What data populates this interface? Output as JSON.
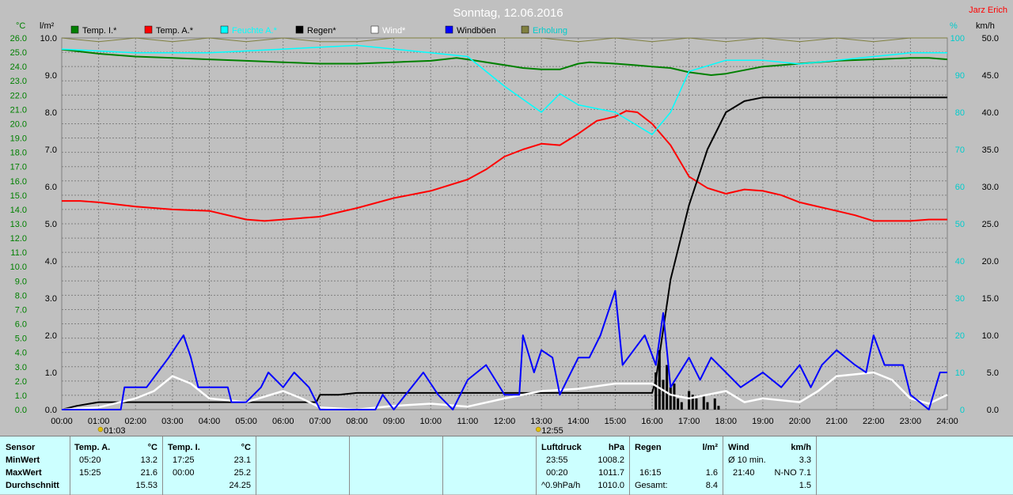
{
  "title": "Sonntag, 12.06.2016",
  "author": "Jarz Erich",
  "axis_units": {
    "left_temp": "°C",
    "left_rain": "l/m²",
    "right_pct": "%",
    "right_kmh": "km/h"
  },
  "legend": [
    {
      "label": "Temp. I.*",
      "color": "#008000"
    },
    {
      "label": "Temp. A.*",
      "color": "#ff0000"
    },
    {
      "label": "Feuchte A.*",
      "color": "#00ffff"
    },
    {
      "label": "Regen*",
      "color": "#000000"
    },
    {
      "label": "Wind*",
      "color": "#ffffff"
    },
    {
      "label": "Windböen",
      "color": "#0000ff"
    },
    {
      "label": "Erholung",
      "color": "#808040"
    }
  ],
  "markers": [
    {
      "label": "01:03"
    },
    {
      "label": "12:55"
    }
  ],
  "chart_data": {
    "type": "line",
    "x_unit": "hours",
    "x_range": [
      0,
      24
    ],
    "x_ticks": [
      "00:00",
      "01:00",
      "02:00",
      "03:00",
      "04:00",
      "05:00",
      "06:00",
      "07:00",
      "08:00",
      "09:00",
      "10:00",
      "11:00",
      "12:00",
      "13:00",
      "14:00",
      "15:00",
      "16:00",
      "17:00",
      "18:00",
      "19:00",
      "20:00",
      "21:00",
      "22:00",
      "23:00",
      "24:00"
    ],
    "temp_axis": {
      "min": 0,
      "max": 26,
      "step": 1
    },
    "rain_axis": {
      "min": 0,
      "max": 10,
      "ticks": [
        "0.0",
        "1.0",
        "2.0",
        "3.0",
        "4.0",
        "5.0",
        "6.0",
        "7.0",
        "8.0",
        "9.0",
        "10.0"
      ]
    },
    "pct_axis": {
      "min": 0,
      "max": 100,
      "step": 10
    },
    "kmh_axis": {
      "min": 0,
      "max": 50,
      "ticks": [
        "0.0",
        "5.0",
        "10.0",
        "15.0",
        "20.0",
        "25.0",
        "30.0",
        "35.0",
        "40.0",
        "45.0",
        "50.0"
      ]
    },
    "series": [
      {
        "name": "Temp. I.*",
        "axis": "temp",
        "color": "#008000",
        "points": [
          [
            0,
            25.2
          ],
          [
            1,
            24.9
          ],
          [
            2,
            24.7
          ],
          [
            3,
            24.6
          ],
          [
            4,
            24.5
          ],
          [
            5,
            24.4
          ],
          [
            6,
            24.3
          ],
          [
            7,
            24.2
          ],
          [
            8,
            24.2
          ],
          [
            9,
            24.3
          ],
          [
            10,
            24.4
          ],
          [
            10.7,
            24.6
          ],
          [
            11,
            24.5
          ],
          [
            12,
            24.1
          ],
          [
            12.5,
            23.9
          ],
          [
            13,
            23.8
          ],
          [
            13.5,
            23.8
          ],
          [
            14,
            24.2
          ],
          [
            14.3,
            24.3
          ],
          [
            15,
            24.2
          ],
          [
            15.5,
            24.1
          ],
          [
            16,
            24.0
          ],
          [
            16.5,
            23.9
          ],
          [
            17,
            23.6
          ],
          [
            17.6,
            23.4
          ],
          [
            18,
            23.5
          ],
          [
            19,
            24.0
          ],
          [
            20,
            24.2
          ],
          [
            21,
            24.4
          ],
          [
            22,
            24.5
          ],
          [
            23,
            24.6
          ],
          [
            23.5,
            24.6
          ],
          [
            24,
            24.5
          ]
        ]
      },
      {
        "name": "Temp. A.*",
        "axis": "temp",
        "color": "#ff0000",
        "points": [
          [
            0,
            14.6
          ],
          [
            0.5,
            14.6
          ],
          [
            1,
            14.5
          ],
          [
            2,
            14.2
          ],
          [
            3,
            14.0
          ],
          [
            4,
            13.9
          ],
          [
            5,
            13.3
          ],
          [
            5.5,
            13.2
          ],
          [
            6,
            13.3
          ],
          [
            7,
            13.5
          ],
          [
            7.5,
            13.8
          ],
          [
            8,
            14.1
          ],
          [
            9,
            14.8
          ],
          [
            10,
            15.3
          ],
          [
            11,
            16.1
          ],
          [
            11.5,
            16.8
          ],
          [
            12,
            17.7
          ],
          [
            12.5,
            18.2
          ],
          [
            13,
            18.6
          ],
          [
            13.5,
            18.5
          ],
          [
            14,
            19.3
          ],
          [
            14.5,
            20.2
          ],
          [
            15,
            20.5
          ],
          [
            15.3,
            20.9
          ],
          [
            15.6,
            20.8
          ],
          [
            16,
            20.0
          ],
          [
            16.5,
            18.5
          ],
          [
            17,
            16.3
          ],
          [
            17.5,
            15.5
          ],
          [
            18,
            15.1
          ],
          [
            18.5,
            15.4
          ],
          [
            19,
            15.3
          ],
          [
            19.5,
            15.0
          ],
          [
            20,
            14.5
          ],
          [
            21,
            13.9
          ],
          [
            21.5,
            13.6
          ],
          [
            22,
            13.2
          ],
          [
            23,
            13.2
          ],
          [
            23.5,
            13.3
          ],
          [
            24,
            13.3
          ]
        ]
      },
      {
        "name": "Feuchte A.*",
        "axis": "pct",
        "color": "#00ffff",
        "points": [
          [
            0,
            97
          ],
          [
            2,
            96
          ],
          [
            4,
            96
          ],
          [
            6,
            97
          ],
          [
            8,
            98
          ],
          [
            10,
            96
          ],
          [
            11,
            95
          ],
          [
            12,
            87
          ],
          [
            13,
            80
          ],
          [
            13.5,
            85
          ],
          [
            14,
            82
          ],
          [
            15,
            80
          ],
          [
            16,
            74
          ],
          [
            16.5,
            80
          ],
          [
            17,
            91
          ],
          [
            18,
            94
          ],
          [
            19,
            94
          ],
          [
            20,
            93
          ],
          [
            21,
            94
          ],
          [
            22,
            95
          ],
          [
            23,
            96
          ],
          [
            24,
            96
          ]
        ]
      },
      {
        "name": "Regen*",
        "axis": "rain",
        "color": "#000000",
        "points": [
          [
            0,
            0.0
          ],
          [
            0.4,
            0.1
          ],
          [
            1,
            0.2
          ],
          [
            3,
            0.2
          ],
          [
            6,
            0.2
          ],
          [
            6.9,
            0.2
          ],
          [
            7,
            0.4
          ],
          [
            7.5,
            0.4
          ],
          [
            8,
            0.45
          ],
          [
            9,
            0.45
          ],
          [
            10,
            0.45
          ],
          [
            12,
            0.45
          ],
          [
            13,
            0.45
          ],
          [
            14,
            0.45
          ],
          [
            15,
            0.45
          ],
          [
            16,
            0.45
          ],
          [
            16.1,
            0.8
          ],
          [
            16.5,
            3.5
          ],
          [
            17,
            5.5
          ],
          [
            17.5,
            7.0
          ],
          [
            18,
            8.0
          ],
          [
            18.5,
            8.3
          ],
          [
            19,
            8.4
          ],
          [
            24,
            8.4
          ]
        ]
      },
      {
        "name": "Wind*",
        "axis": "kmh",
        "color": "#ffffff",
        "points": [
          [
            0,
            0
          ],
          [
            1,
            0.3
          ],
          [
            2,
            1.5
          ],
          [
            2.5,
            2.5
          ],
          [
            3,
            4.5
          ],
          [
            3.5,
            3.5
          ],
          [
            4,
            1.5
          ],
          [
            5,
            1.0
          ],
          [
            6,
            2.5
          ],
          [
            6.5,
            1.5
          ],
          [
            7,
            0.3
          ],
          [
            8,
            0
          ],
          [
            9,
            0.5
          ],
          [
            10,
            0.8
          ],
          [
            11,
            0.4
          ],
          [
            12,
            1.5
          ],
          [
            13,
            2.5
          ],
          [
            14,
            2.8
          ],
          [
            15,
            3.5
          ],
          [
            16,
            3.5
          ],
          [
            16.5,
            2.0
          ],
          [
            17,
            1.5
          ],
          [
            18,
            2.5
          ],
          [
            18.5,
            1.0
          ],
          [
            19,
            1.5
          ],
          [
            20,
            1.0
          ],
          [
            20.5,
            2.5
          ],
          [
            21,
            4.5
          ],
          [
            22,
            5.0
          ],
          [
            22.5,
            4.0
          ],
          [
            23,
            1.5
          ],
          [
            23.5,
            0.8
          ],
          [
            24,
            2.0
          ]
        ]
      },
      {
        "name": "Windböen",
        "axis": "kmh",
        "color": "#0000ff",
        "points": [
          [
            0,
            0
          ],
          [
            1.6,
            0
          ],
          [
            1.7,
            3
          ],
          [
            2.3,
            3
          ],
          [
            2.6,
            5
          ],
          [
            2.9,
            7
          ],
          [
            3.3,
            10
          ],
          [
            3.5,
            7
          ],
          [
            3.7,
            3
          ],
          [
            4,
            3
          ],
          [
            4.5,
            3
          ],
          [
            4.6,
            1
          ],
          [
            5,
            1
          ],
          [
            5.4,
            3
          ],
          [
            5.6,
            5
          ],
          [
            6,
            3
          ],
          [
            6.3,
            5
          ],
          [
            6.7,
            3
          ],
          [
            7,
            0
          ],
          [
            8.5,
            0
          ],
          [
            8.7,
            2
          ],
          [
            9,
            0
          ],
          [
            9.8,
            5
          ],
          [
            10.2,
            2
          ],
          [
            10.6,
            0
          ],
          [
            11,
            4
          ],
          [
            11.5,
            6
          ],
          [
            12,
            2
          ],
          [
            12.4,
            2
          ],
          [
            12.5,
            10
          ],
          [
            12.8,
            5
          ],
          [
            13,
            8
          ],
          [
            13.3,
            7
          ],
          [
            13.5,
            2
          ],
          [
            14,
            7
          ],
          [
            14.3,
            7
          ],
          [
            14.6,
            10
          ],
          [
            15,
            16
          ],
          [
            15.2,
            6
          ],
          [
            15.5,
            8
          ],
          [
            15.8,
            10
          ],
          [
            16.1,
            6
          ],
          [
            16.3,
            13
          ],
          [
            16.5,
            3
          ],
          [
            17,
            7
          ],
          [
            17.3,
            4
          ],
          [
            17.6,
            7
          ],
          [
            18,
            5
          ],
          [
            18.4,
            3
          ],
          [
            19,
            5
          ],
          [
            19.5,
            3
          ],
          [
            20,
            6
          ],
          [
            20.3,
            3
          ],
          [
            20.6,
            6
          ],
          [
            21,
            8
          ],
          [
            21.5,
            6
          ],
          [
            21.8,
            5
          ],
          [
            22,
            10
          ],
          [
            22.3,
            6
          ],
          [
            22.8,
            6
          ],
          [
            23,
            2
          ],
          [
            23.5,
            0
          ],
          [
            23.8,
            5
          ],
          [
            24,
            5
          ]
        ]
      },
      {
        "name": "Erholung",
        "axis": "pct",
        "color": "#808040",
        "points": [
          [
            0,
            100
          ],
          [
            1,
            99
          ],
          [
            2,
            100
          ],
          [
            3,
            99
          ],
          [
            4,
            100
          ],
          [
            5,
            99
          ],
          [
            6,
            100
          ],
          [
            7,
            99
          ],
          [
            8,
            99
          ],
          [
            9,
            100
          ],
          [
            10,
            100
          ],
          [
            11,
            100
          ],
          [
            12,
            100
          ],
          [
            13,
            100
          ],
          [
            14,
            99
          ],
          [
            15,
            100
          ],
          [
            16,
            99
          ],
          [
            17,
            100
          ],
          [
            18,
            99
          ],
          [
            19,
            100
          ],
          [
            20,
            99
          ],
          [
            21,
            100
          ],
          [
            22,
            99
          ],
          [
            23,
            100
          ],
          [
            24,
            100
          ]
        ]
      }
    ],
    "rain_bars": {
      "axis": "rain",
      "color": "#000000",
      "points": [
        [
          16.1,
          1.0
        ],
        [
          16.2,
          1.6
        ],
        [
          16.3,
          0.8
        ],
        [
          16.4,
          1.2
        ],
        [
          16.5,
          0.6
        ],
        [
          16.6,
          0.7
        ],
        [
          16.7,
          0.3
        ],
        [
          16.8,
          0.2
        ],
        [
          17.0,
          0.5
        ],
        [
          17.1,
          0.4
        ],
        [
          17.2,
          0.3
        ],
        [
          17.4,
          0.4
        ],
        [
          17.5,
          0.2
        ],
        [
          17.7,
          0.3
        ],
        [
          17.8,
          0.1
        ]
      ]
    }
  },
  "stats": {
    "sensor": {
      "header": "Sensor",
      "rows": [
        "MinWert",
        "MaxWert",
        "Durchschnitt"
      ]
    },
    "temp_a": {
      "header": "Temp. A.",
      "unit": "°C",
      "min_time": "05:20",
      "min_val": "13.2",
      "max_time": "15:25",
      "max_val": "21.6",
      "avg": "15.53"
    },
    "temp_i": {
      "header": "Temp. I.",
      "unit": "°C",
      "min_time": "17:25",
      "min_val": "23.1",
      "max_time": "00:00",
      "max_val": "25.2",
      "avg": "24.25"
    },
    "luftdruck": {
      "header": "Luftdruck",
      "unit": "hPa",
      "min_time": "23:55",
      "min_val": "1008.2",
      "max_time": "00:20",
      "max_val": "1011.7",
      "avg_label": "^0.9hPa/h",
      "avg": "1010.0"
    },
    "regen": {
      "header": "Regen",
      "unit": "l/m²",
      "max_time": "16:15",
      "max_val": "1.6",
      "total_label": "Gesamt:",
      "total": "8.4"
    },
    "wind": {
      "header": "Wind",
      "unit": "km/h",
      "min_label": "Ø 10 min.",
      "min_val": "3.3",
      "max_time": "21:40",
      "max_val": "N-NO 7.1",
      "avg": "1.5"
    }
  }
}
